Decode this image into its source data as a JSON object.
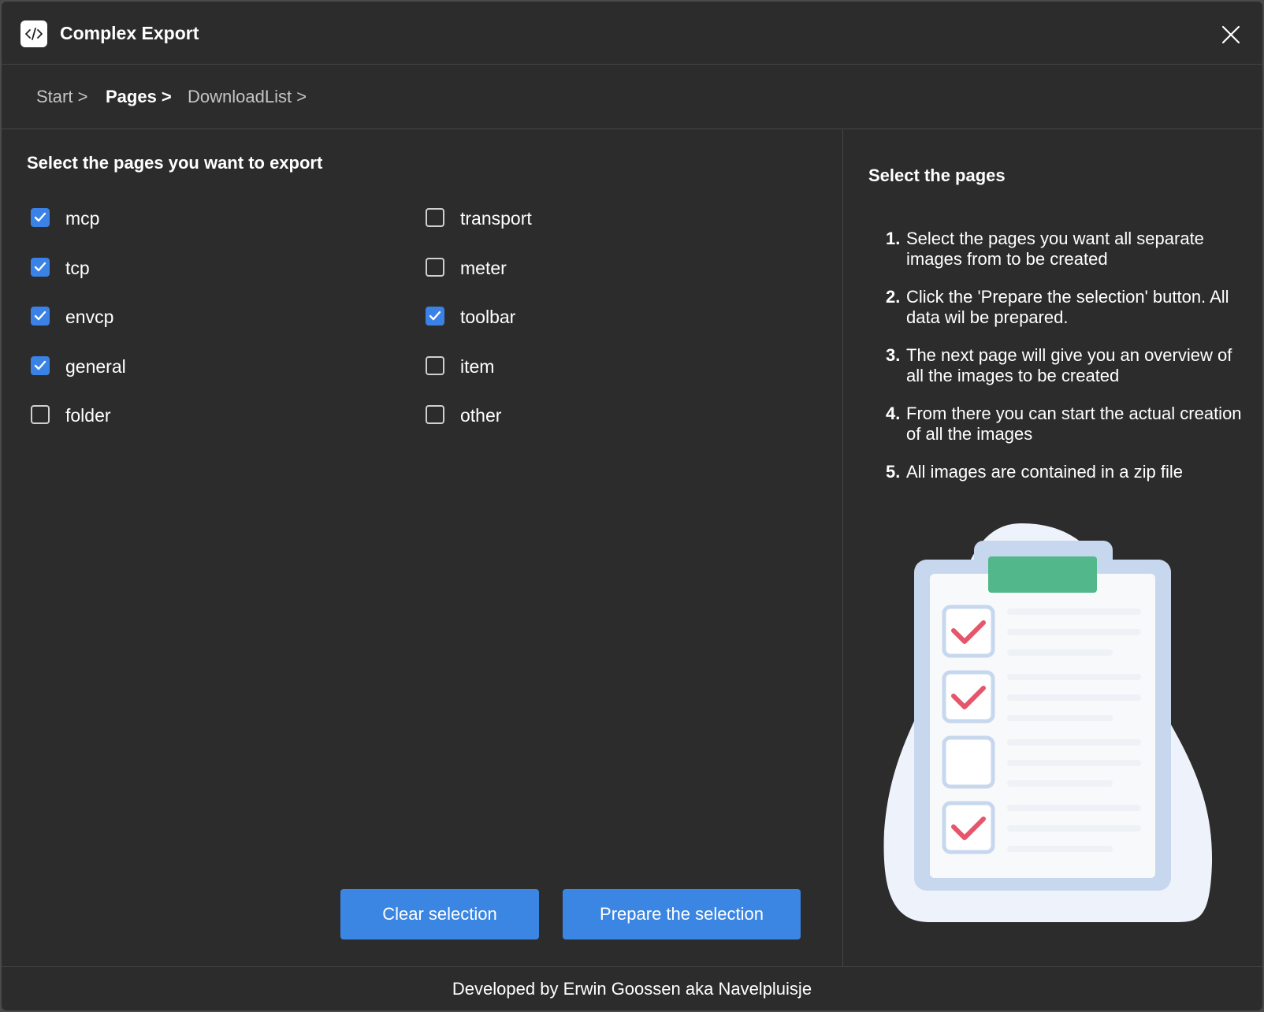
{
  "window": {
    "title": "Complex Export",
    "app_icon": "code-icon",
    "close_icon": "close-icon"
  },
  "breadcrumb": [
    {
      "label": "Start >",
      "active": false
    },
    {
      "label": "Pages >",
      "active": true
    },
    {
      "label": "DownloadList >",
      "active": false
    }
  ],
  "pages": {
    "heading": "Select the pages you want to export",
    "left_column": [
      {
        "label": "mcp",
        "checked": true
      },
      {
        "label": "tcp",
        "checked": true
      },
      {
        "label": "envcp",
        "checked": true
      },
      {
        "label": "general",
        "checked": true
      },
      {
        "label": "folder",
        "checked": false
      }
    ],
    "right_column": [
      {
        "label": "transport",
        "checked": false
      },
      {
        "label": "meter",
        "checked": false
      },
      {
        "label": "toolbar",
        "checked": true
      },
      {
        "label": "item",
        "checked": false
      },
      {
        "label": "other",
        "checked": false
      }
    ],
    "clear_button": "Clear selection",
    "prepare_button": "Prepare the selection"
  },
  "help": {
    "title": "Select the pages",
    "steps": [
      {
        "num": "1.",
        "text": "Select the pages you want all separate images from to be created"
      },
      {
        "num": "2.",
        "text": "Click the 'Prepare the selection' button. All data wil be prepared."
      },
      {
        "num": "3.",
        "text": "The next page will give you an overview of all the images to be created"
      },
      {
        "num": "4.",
        "text": "From there you can start the actual creation of all the images"
      },
      {
        "num": "5.",
        "text": "All images are contained in a zip file"
      }
    ],
    "illustration": "clipboard-checklist-illustration"
  },
  "footer": {
    "text": "Developed by Erwin Goossen aka Navelpluisje"
  },
  "colors": {
    "background": "#2c2c2c",
    "accent": "#3b86e3",
    "checkmark": "#e5566b",
    "clip": "#52b78a"
  }
}
